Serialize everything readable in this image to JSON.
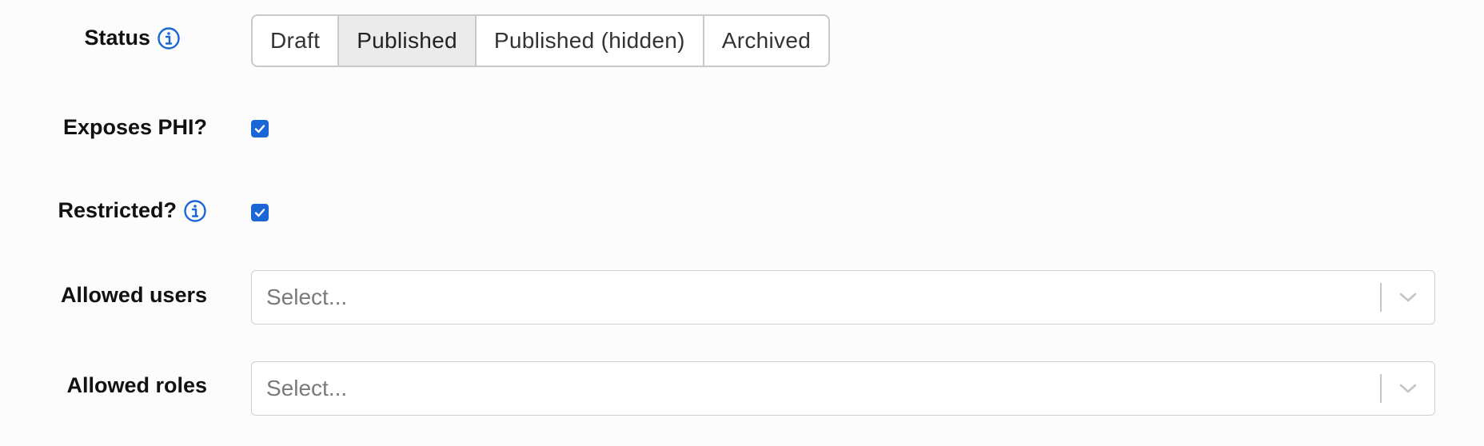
{
  "status": {
    "label": "Status",
    "options": [
      "Draft",
      "Published",
      "Published (hidden)",
      "Archived"
    ],
    "selected": "Published"
  },
  "exposes_phi": {
    "label": "Exposes PHI?",
    "checked": true
  },
  "restricted": {
    "label": "Restricted?",
    "checked": true
  },
  "allowed_users": {
    "label": "Allowed users",
    "placeholder": "Select..."
  },
  "allowed_roles": {
    "label": "Allowed roles",
    "placeholder": "Select..."
  },
  "colors": {
    "accent": "#1a66d6",
    "info_icon": "#1a66d6",
    "selected_segment_bg": "#ebebeb"
  },
  "icons": [
    "info-icon",
    "checkmark-icon",
    "chevron-down-icon"
  ]
}
